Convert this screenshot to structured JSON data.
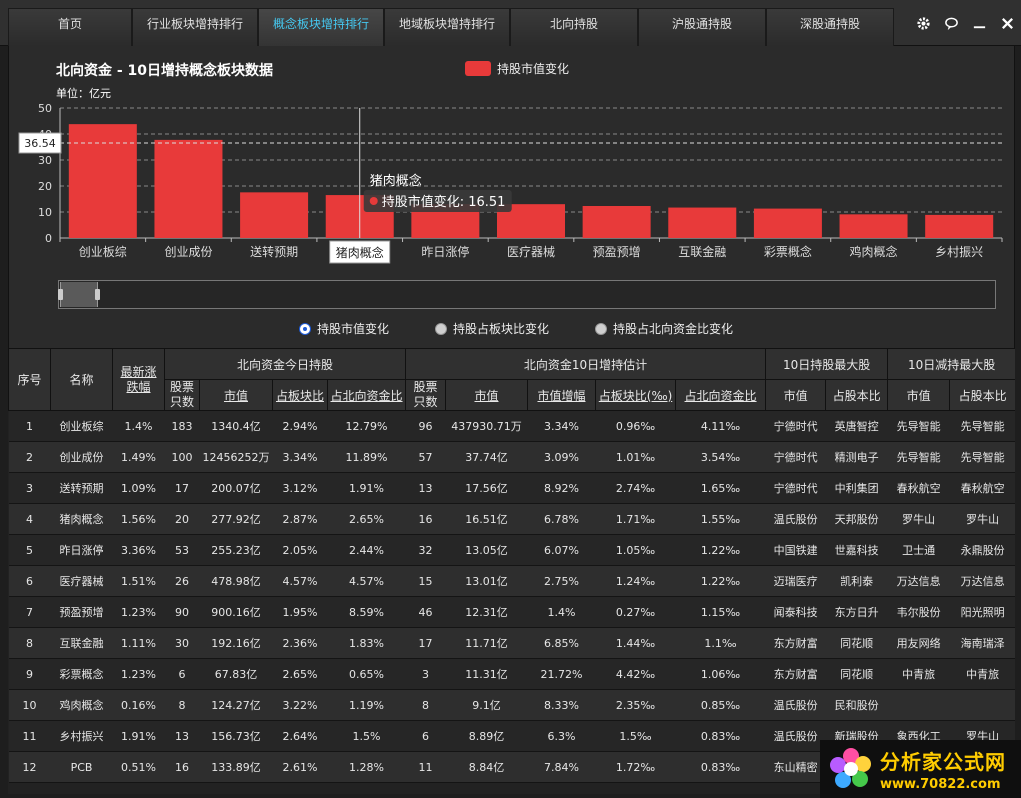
{
  "nav": {
    "tabs": [
      {
        "label": "首页",
        "active": false
      },
      {
        "label": "行业板块增持排行",
        "active": false
      },
      {
        "label": "概念板块增持排行",
        "active": true
      },
      {
        "label": "地域板块增持排行",
        "active": false
      },
      {
        "label": "北向持股",
        "active": false
      },
      {
        "label": "沪股通持股",
        "active": false
      },
      {
        "label": "深股通持股",
        "active": false
      }
    ],
    "window_icons": [
      "gear-icon",
      "speech-icon",
      "minimize-icon",
      "close-icon"
    ]
  },
  "chart_data": {
    "type": "bar",
    "title": "北向资金 - 10日增持概念板块数据",
    "unit_label": "单位：亿元",
    "legend": "持股市值变化",
    "color": "#e83a3a",
    "ylim": [
      0,
      50
    ],
    "yticks": [
      0,
      10,
      20,
      30,
      40,
      50
    ],
    "categories": [
      "创业板综",
      "创业成份",
      "送转预期",
      "猪肉概念",
      "昨日涨停",
      "医疗器械",
      "预盈预增",
      "互联金融",
      "彩票概念",
      "鸡肉概念",
      "乡村振兴"
    ],
    "series": [
      {
        "name": "持股市值变化",
        "values": [
          43.79,
          37.74,
          17.56,
          16.51,
          13.05,
          13.01,
          12.31,
          11.71,
          11.31,
          9.1,
          8.89
        ]
      }
    ],
    "crosshair": {
      "category": "猪肉概念",
      "y_readout": "36.54",
      "tooltip_title": "猪肉概念",
      "tooltip_text": "持股市值变化: 16.51"
    }
  },
  "radios": [
    {
      "label": "持股市值变化",
      "selected": true
    },
    {
      "label": "持股占板块比变化",
      "selected": false
    },
    {
      "label": "持股占北向资金比变化",
      "selected": false
    }
  ],
  "table": {
    "groups": {
      "today": "北向资金今日持股",
      "tenday": "北向资金10日增持估计",
      "maxhold": "10日持股最大股",
      "maxreduce": "10日减持最大股"
    },
    "headers": {
      "idx": "序号",
      "name": "名称",
      "chg": "最新涨跌幅",
      "t_count": "股票只数",
      "t_mv": "市值",
      "t_pct": "占板块比",
      "t_nb": "占北向资金比",
      "d_count": "股票只数",
      "d_mv": "市值",
      "d_inc": "市值增幅",
      "d_pct": "占板块比(‰)",
      "d_nb": "占北向资金比",
      "h_mv": "市值",
      "h_own": "占股本比",
      "r_mv": "市值",
      "r_own": "占股本比"
    },
    "rows": [
      [
        "1",
        "创业板综",
        "1.4%",
        "183",
        "1340.4亿",
        "2.94%",
        "12.79%",
        "96",
        "437930.71万",
        "3.34%",
        "0.96‰",
        "4.11‰",
        "宁德时代",
        "英唐智控",
        "先导智能",
        "先导智能"
      ],
      [
        "2",
        "创业成份",
        "1.49%",
        "100",
        "12456252万",
        "3.34%",
        "11.89%",
        "57",
        "37.74亿",
        "3.09%",
        "1.01‰",
        "3.54‰",
        "宁德时代",
        "精测电子",
        "先导智能",
        "先导智能"
      ],
      [
        "3",
        "送转预期",
        "1.09%",
        "17",
        "200.07亿",
        "3.12%",
        "1.91%",
        "13",
        "17.56亿",
        "8.92%",
        "2.74‰",
        "1.65‰",
        "宁德时代",
        "中利集团",
        "春秋航空",
        "春秋航空"
      ],
      [
        "4",
        "猪肉概念",
        "1.56%",
        "20",
        "277.92亿",
        "2.87%",
        "2.65%",
        "16",
        "16.51亿",
        "6.78%",
        "1.71‰",
        "1.55‰",
        "温氏股份",
        "天邦股份",
        "罗牛山",
        "罗牛山"
      ],
      [
        "5",
        "昨日涨停",
        "3.36%",
        "53",
        "255.23亿",
        "2.05%",
        "2.44%",
        "32",
        "13.05亿",
        "6.07%",
        "1.05‰",
        "1.22‰",
        "中国铁建",
        "世嘉科技",
        "卫士通",
        "永鼎股份"
      ],
      [
        "6",
        "医疗器械",
        "1.51%",
        "26",
        "478.98亿",
        "4.57%",
        "4.57%",
        "15",
        "13.01亿",
        "2.75%",
        "1.24‰",
        "1.22‰",
        "迈瑞医疗",
        "凯利泰",
        "万达信息",
        "万达信息"
      ],
      [
        "7",
        "预盈预增",
        "1.23%",
        "90",
        "900.16亿",
        "1.95%",
        "8.59%",
        "46",
        "12.31亿",
        "1.4%",
        "0.27‰",
        "1.15‰",
        "闻泰科技",
        "东方日升",
        "韦尔股份",
        "阳光照明"
      ],
      [
        "8",
        "互联金融",
        "1.11%",
        "30",
        "192.16亿",
        "2.36%",
        "1.83%",
        "17",
        "11.71亿",
        "6.85%",
        "1.44‰",
        "1.1‰",
        "东方财富",
        "同花顺",
        "用友网络",
        "海南瑞泽"
      ],
      [
        "9",
        "彩票概念",
        "1.23%",
        "6",
        "67.83亿",
        "2.65%",
        "0.65%",
        "3",
        "11.31亿",
        "21.72%",
        "4.42‰",
        "1.06‰",
        "东方财富",
        "同花顺",
        "中青旅",
        "中青旅"
      ],
      [
        "10",
        "鸡肉概念",
        "0.16%",
        "8",
        "124.27亿",
        "3.22%",
        "1.19%",
        "8",
        "9.1亿",
        "8.33%",
        "2.35‰",
        "0.85‰",
        "温氏股份",
        "民和股份",
        "",
        ""
      ],
      [
        "11",
        "乡村振兴",
        "1.91%",
        "13",
        "156.73亿",
        "2.64%",
        "1.5%",
        "6",
        "8.89亿",
        "6.3%",
        "1.5‰",
        "0.83‰",
        "温氏股份",
        "新瑞股份",
        "象西化工",
        "罗牛山"
      ],
      [
        "12",
        "PCB",
        "0.51%",
        "16",
        "133.89亿",
        "2.61%",
        "1.28%",
        "11",
        "8.84亿",
        "7.84%",
        "1.72‰",
        "0.83‰",
        "东山精密",
        "",
        "",
        ""
      ]
    ]
  },
  "watermark": {
    "line1": "分析家公式网",
    "line2": "www.70822.com"
  }
}
